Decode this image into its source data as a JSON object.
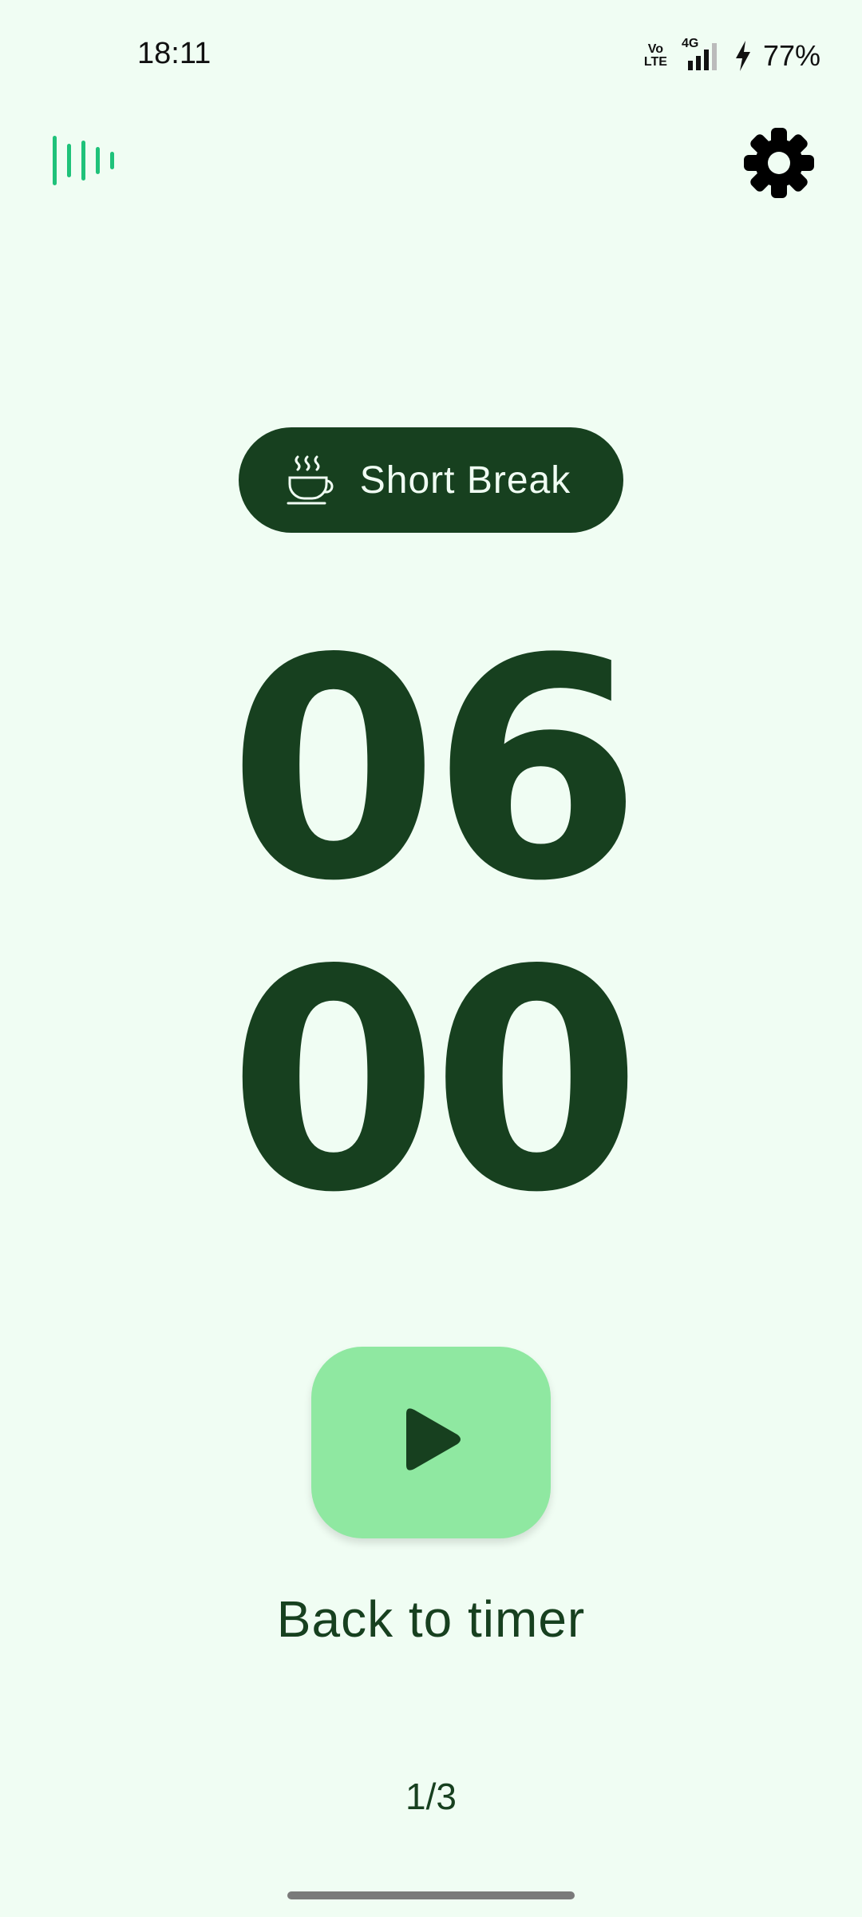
{
  "status_bar": {
    "time": "18:11",
    "battery": "77%",
    "volte_label_top": "Vo",
    "volte_label_bottom": "LTE",
    "network_label": "4G",
    "icons": [
      "volte-icon",
      "signal-icon",
      "charging-icon"
    ]
  },
  "header": {
    "stats_icon": "bar-chart-icon",
    "settings_icon": "gear-icon",
    "accent_color": "#1fc27a"
  },
  "mode_chip": {
    "icon": "coffee-cup-icon",
    "label": "Short Break"
  },
  "timer": {
    "minutes": "06",
    "seconds": "00"
  },
  "controls": {
    "play_icon": "play-icon",
    "back_label": "Back to timer"
  },
  "session": {
    "indicator": "1/3"
  },
  "colors": {
    "background": "#f0fdf3",
    "primary_dark": "#17401f",
    "play_button": "#8fe8a1"
  }
}
